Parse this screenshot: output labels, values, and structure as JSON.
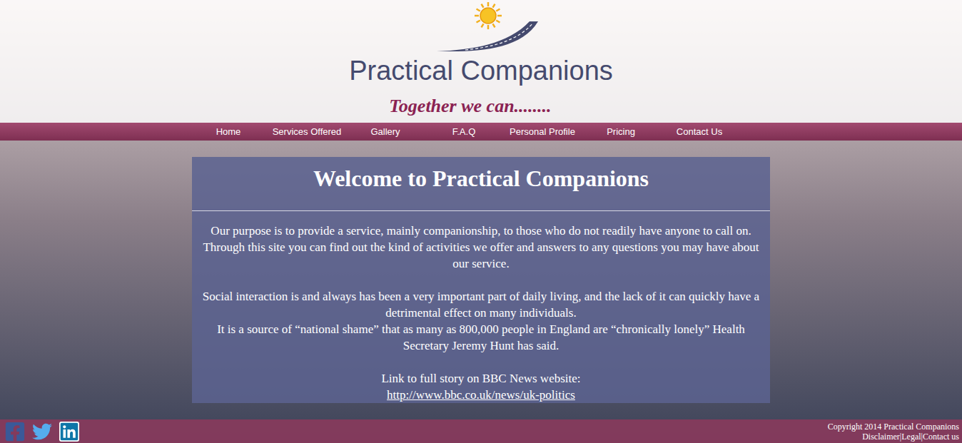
{
  "logo": {
    "name": "Practical Companions",
    "tagline": "Together we can........"
  },
  "nav": [
    {
      "label": "Home"
    },
    {
      "label": "Services Offered"
    },
    {
      "label": "Gallery"
    },
    {
      "label": "F.A.Q"
    },
    {
      "label": "Personal Profile"
    },
    {
      "label": "Pricing"
    },
    {
      "label": "Contact Us"
    }
  ],
  "panel": {
    "title": "Welcome to Practical Companions",
    "blocks": [
      [
        {
          "kind": "text",
          "text": "Our purpose is to provide a service, mainly companionship, to those who do not readily have anyone to call on."
        },
        {
          "kind": "text",
          "text": "Through this site you can find out the kind of activities we offer and answers to any questions you may have about our service."
        }
      ],
      [
        {
          "kind": "text",
          "text": "Social interaction is and always has been a very important part of daily living, and the lack of it can quickly have a detrimental effect on many individuals."
        },
        {
          "kind": "text",
          "text": "It is a source of “national shame” that as many as 800,000 people in England are “chronically lonely” Health Secretary Jeremy Hunt has said."
        }
      ],
      [
        {
          "kind": "text",
          "text": "Link to full story on BBC News website:"
        },
        {
          "kind": "link",
          "text": "http://www.bbc.co.uk/news/uk-politics"
        }
      ]
    ]
  },
  "footer": {
    "copyright": "Copyright 2014 Practical Companions",
    "links": [
      "Disclaimer",
      "Legal",
      "Contact us"
    ],
    "separator": "|"
  }
}
